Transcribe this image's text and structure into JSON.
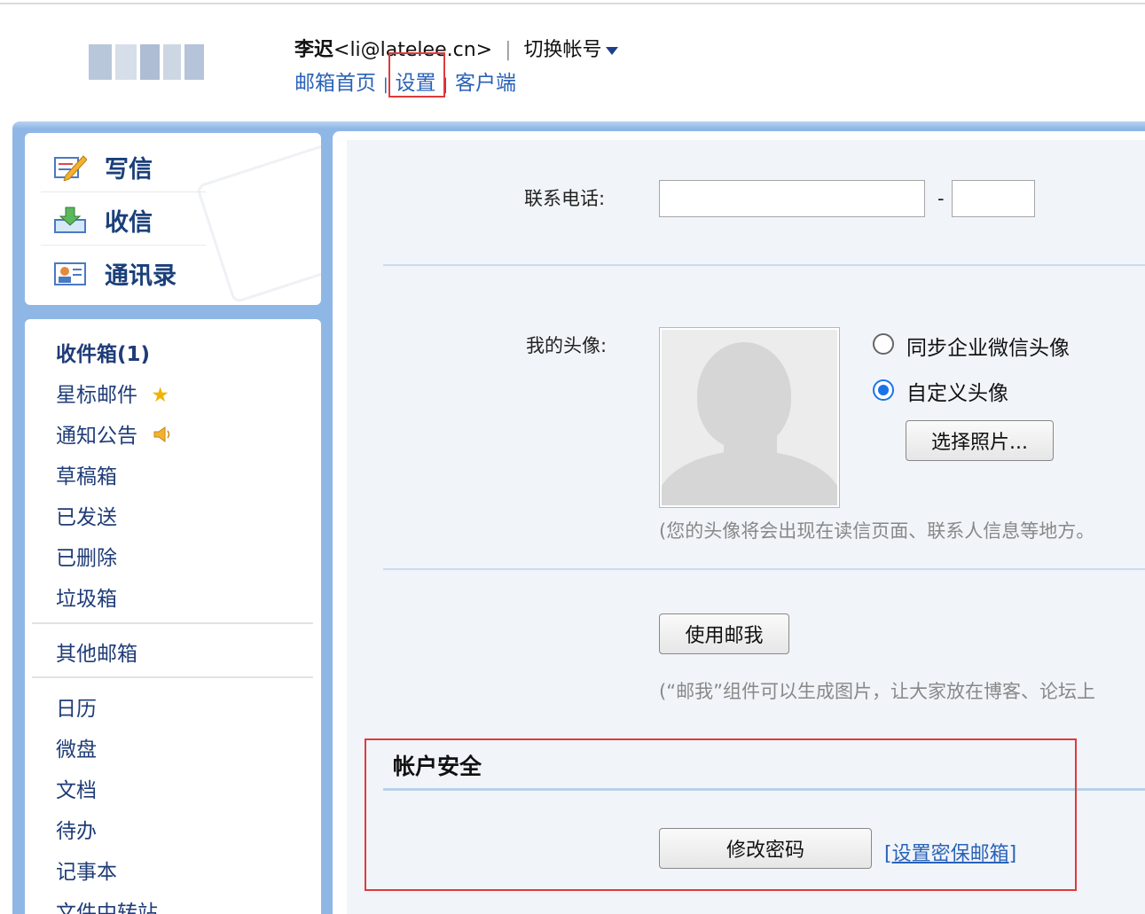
{
  "header": {
    "user_name": "李迟",
    "user_email": "<li@latelee.cn>",
    "separator": "|",
    "switch_account": "切换帐号",
    "links": [
      "邮箱首页",
      "设置",
      "客户端"
    ]
  },
  "quick_actions": {
    "compose": "写信",
    "receive": "收信",
    "contacts": "通讯录"
  },
  "folders": {
    "inbox": "收件箱(1)",
    "starred": "星标邮件",
    "announcements": "通知公告",
    "drafts": "草稿箱",
    "sent": "已发送",
    "deleted": "已删除",
    "spam": "垃圾箱",
    "other_mailboxes": "其他邮箱",
    "calendar": "日历",
    "disk": "微盘",
    "docs": "文档",
    "todo": "待办",
    "notes": "记事本",
    "file_transfer": "文件中转站"
  },
  "form": {
    "phone_label": "联系电话:",
    "phone_dash": "-",
    "avatar_label": "我的头像:",
    "sync_wechat_avatar": "同步企业微信头像",
    "custom_avatar": "自定义头像",
    "avatar_selected": "custom",
    "choose_photo_button": "选择照片...",
    "avatar_note": "(您的头像将会出现在读信页面、联系人信息等地方。",
    "use_mail_me_button": "使用邮我",
    "mail_me_note": "(“邮我”组件可以生成图片，让大家放在博客、论坛上"
  },
  "security": {
    "title": "帐户安全",
    "change_password_button": "修改密码",
    "set_security_email_link": "[设置密保邮箱]"
  },
  "colors": {
    "frame_blue": "#8fb7e6",
    "link_blue": "#2a62b8",
    "highlight_red": "#e03a3a",
    "radio_blue": "#1a73e8"
  }
}
